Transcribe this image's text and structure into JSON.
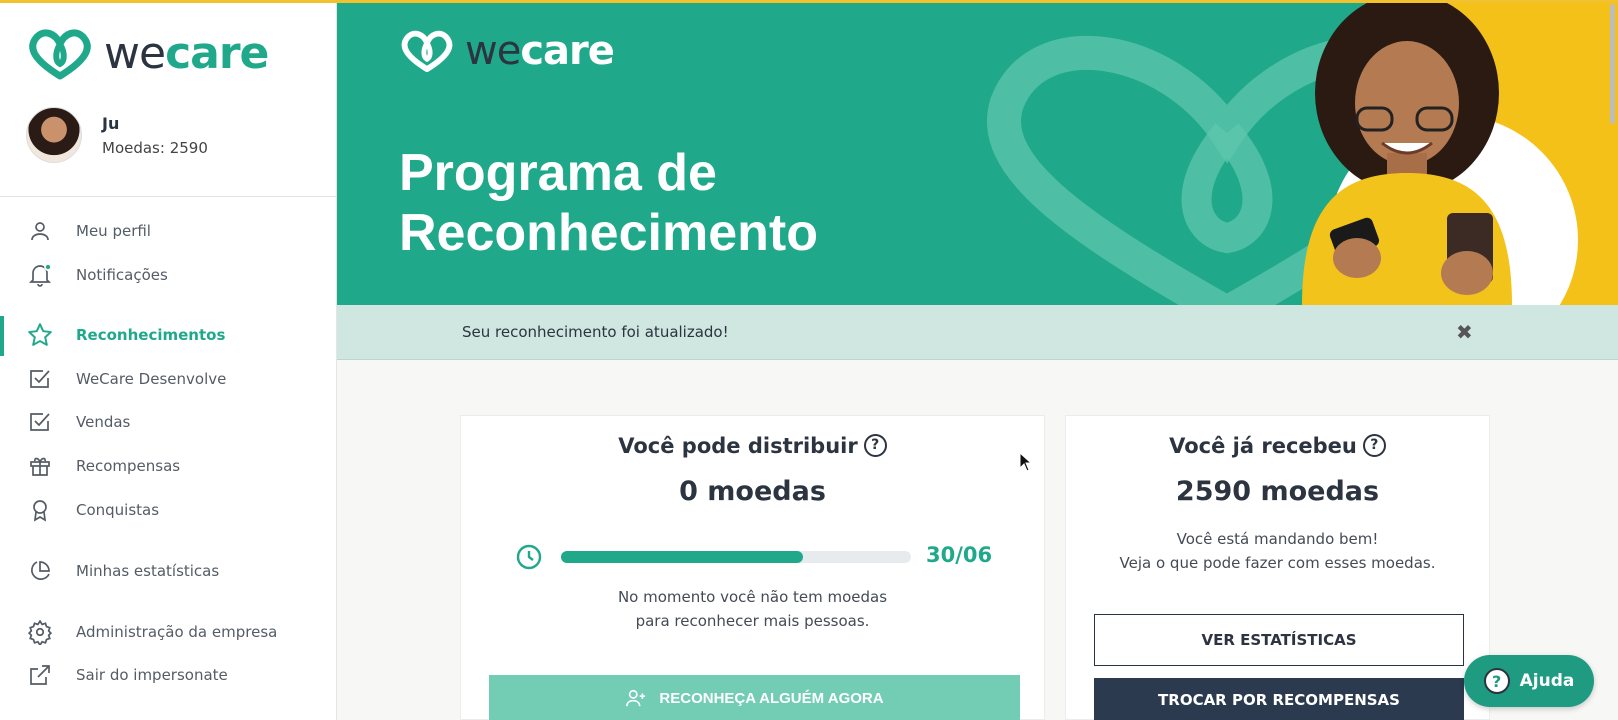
{
  "brand": {
    "we": "we",
    "care": "care",
    "accent": "#1fa98a",
    "yellow": "#f4c119",
    "dark": "#2b3440"
  },
  "user": {
    "name": "Ju",
    "coins_label": "Moedas: 2590"
  },
  "nav": [
    {
      "label": "Meu perfil",
      "icon": "user-icon"
    },
    {
      "label": "Notificações",
      "icon": "bell-icon"
    },
    {
      "label": "Reconhecimentos",
      "icon": "star-icon",
      "active": true
    },
    {
      "label": "WeCare Desenvolve",
      "icon": "checkbox-icon"
    },
    {
      "label": "Vendas",
      "icon": "checkbox-icon"
    },
    {
      "label": "Recompensas",
      "icon": "gift-icon"
    },
    {
      "label": "Conquistas",
      "icon": "award-icon"
    },
    {
      "label": "Minhas estatísticas",
      "icon": "pie-chart-icon"
    },
    {
      "label": "Administração da empresa",
      "icon": "gear-icon"
    },
    {
      "label": "Sair do impersonate",
      "icon": "external-link-icon"
    }
  ],
  "banner": {
    "title_line1": "Programa de",
    "title_line2": "Reconhecimento"
  },
  "alert": {
    "message": "Seu reconhecimento foi atualizado!",
    "close": "✖"
  },
  "distribute": {
    "title": "Você pode distribuir",
    "help": "?",
    "amount": "0 moedas",
    "progress": 0.69,
    "deadline": "30/06",
    "message_line1": "No momento você não tem moedas",
    "message_line2": "para reconhecer mais pessoas.",
    "button": "RECONHEÇA ALGUÉM AGORA"
  },
  "received": {
    "title": "Você já recebeu",
    "help": "?",
    "amount": "2590 moedas",
    "message_line1": "Você está mandando bem!",
    "message_line2": "Veja o que pode fazer com esses moedas.",
    "stats_button": "VER ESTATÍSTICAS",
    "trade_button": "TROCAR POR RECOMPENSAS"
  },
  "help_widget": {
    "label": "Ajuda",
    "icon": "?"
  }
}
